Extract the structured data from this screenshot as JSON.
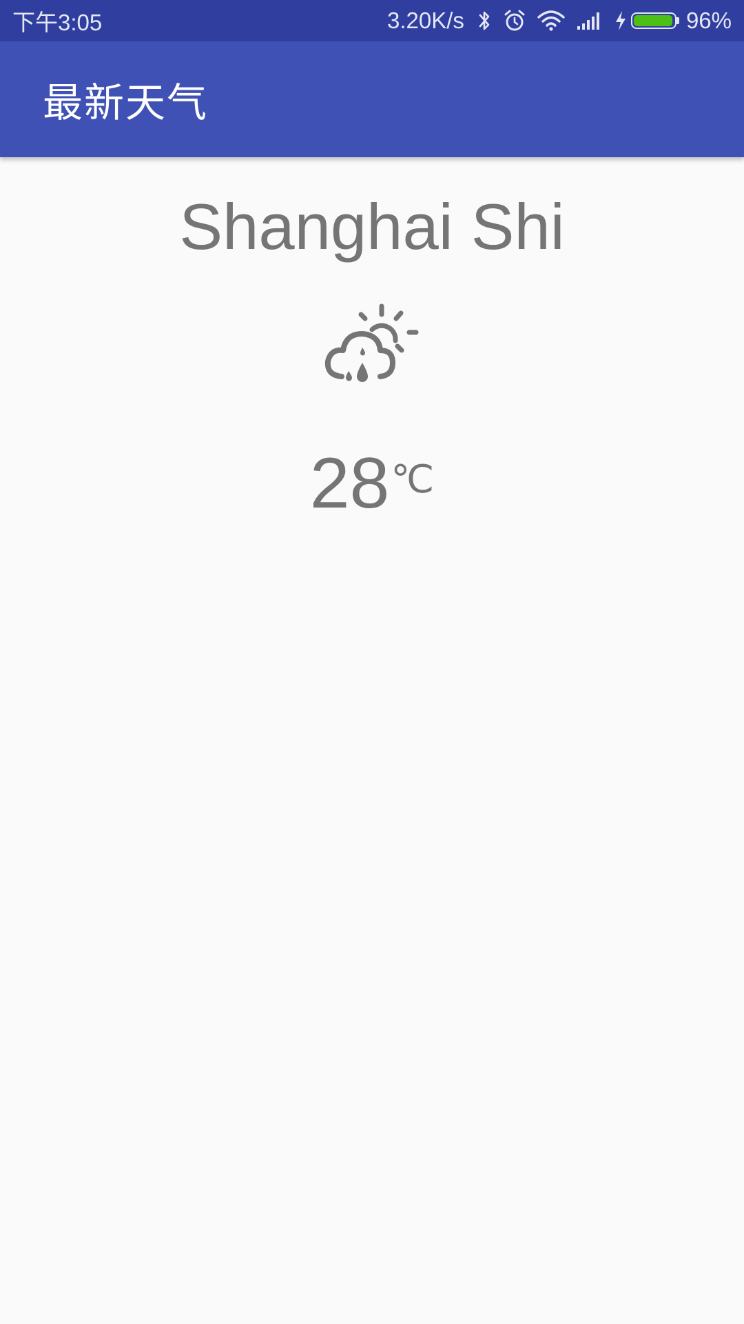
{
  "status_bar": {
    "time": "下午3:05",
    "net_speed": "3.20K/s",
    "battery_percent": "96%",
    "battery_level": 0.96,
    "icons": [
      "bluetooth-icon",
      "alarm-icon",
      "wifi-icon",
      "signal-icon",
      "charging-icon",
      "battery-icon"
    ]
  },
  "app_bar": {
    "title": "最新天气"
  },
  "weather": {
    "city": "Shanghai Shi",
    "condition_icon": "cloud-sun-rain-icon",
    "temperature": "28",
    "unit": "℃"
  },
  "colors": {
    "status_bar": "#303f9f",
    "app_bar": "#3f51b5",
    "background": "#fafafa",
    "text": "#757575",
    "battery_fill": "#4cc014"
  }
}
